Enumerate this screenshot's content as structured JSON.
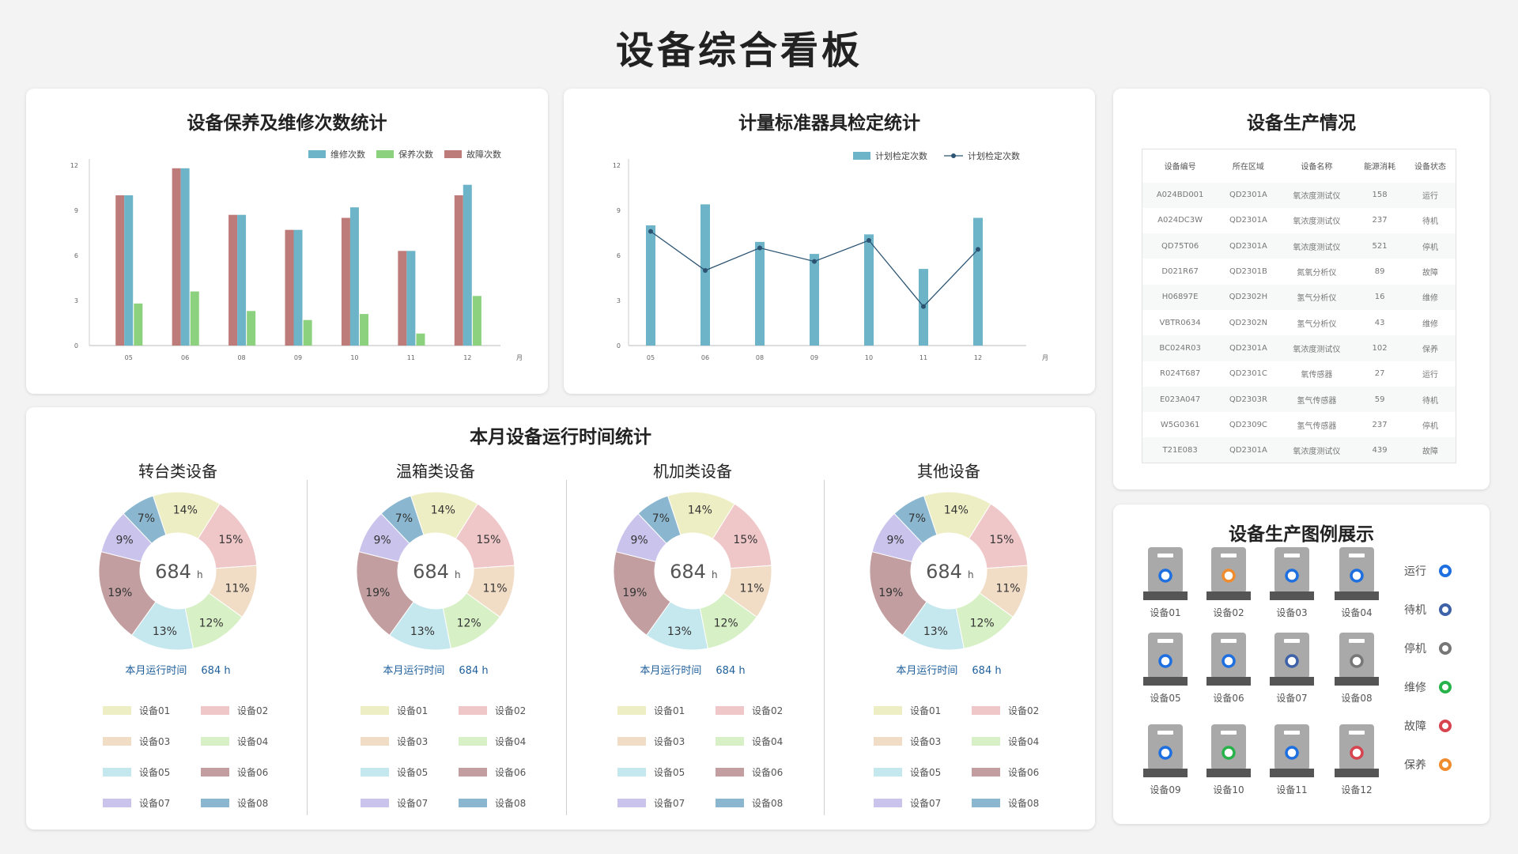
{
  "page_title": "设备综合看板",
  "colors": {
    "run": "#1e6fe0",
    "standby": "#3e62a8",
    "stop": "#777777",
    "maintain": "#27b24a",
    "fault": "#d7434f",
    "upkeep": "#f08c2d"
  },
  "cards": {
    "maint_title": "设备保养及维修次数统计",
    "calib_title": "计量标准器具检定统计",
    "prod_title": "设备生产情况",
    "runtime_title": "本月设备运行时间统计",
    "legend_title": "设备生产图例展示"
  },
  "chart_data": [
    {
      "type": "bar",
      "title": "设备保养及维修次数统计",
      "categories": [
        "05",
        "06",
        "08",
        "09",
        "10",
        "11",
        "12"
      ],
      "x_unit": "月",
      "ylim": [
        0,
        12
      ],
      "yticks": [
        0,
        3,
        6,
        9,
        12
      ],
      "series": [
        {
          "name": "故障次数",
          "color": "#bd7c79",
          "values": [
            10,
            11.8,
            8.7,
            7.7,
            8.5,
            6.3,
            10
          ]
        },
        {
          "name": "维修次数",
          "color": "#6eb4c8",
          "values": [
            10,
            11.8,
            8.7,
            7.7,
            9.2,
            6.3,
            10.7
          ]
        },
        {
          "name": "保养次数",
          "color": "#8bd17e",
          "values": [
            2.8,
            3.6,
            2.3,
            1.7,
            2.1,
            0.8,
            3.3
          ]
        }
      ],
      "legend": [
        {
          "name": "维修次数",
          "color": "#6eb4c8"
        },
        {
          "name": "保养次数",
          "color": "#8bd17e"
        },
        {
          "name": "故障次数",
          "color": "#bd7c79"
        }
      ]
    },
    {
      "type": "bar",
      "title": "计量标准器具检定统计",
      "categories": [
        "05",
        "06",
        "08",
        "09",
        "10",
        "11",
        "12"
      ],
      "x_unit": "月",
      "ylim": [
        0,
        12
      ],
      "yticks": [
        0,
        3,
        6,
        9,
        12
      ],
      "series": [
        {
          "name": "计划检定次数",
          "kind": "bar",
          "color": "#6eb4c8",
          "values": [
            8,
            9.4,
            6.9,
            6.1,
            7.4,
            5.1,
            8.5
          ]
        },
        {
          "name": "计划检定次数",
          "kind": "line",
          "color": "#2c5472",
          "values": [
            7.6,
            5,
            6.5,
            5.6,
            7,
            2.6,
            6.4
          ]
        }
      ]
    },
    {
      "type": "pie",
      "title": "转台类设备",
      "center_value": "684",
      "center_unit": "h",
      "summary_label": "本月运行时间",
      "summary_value": "684 h",
      "slices": [
        {
          "label": "设备01",
          "pct": 14,
          "color": "#eeeec5"
        },
        {
          "label": "设备02",
          "pct": 15,
          "color": "#f0c7c9"
        },
        {
          "label": "设备03",
          "pct": 11,
          "color": "#f1dcc6"
        },
        {
          "label": "设备04",
          "pct": 12,
          "color": "#d7f0c5"
        },
        {
          "label": "设备05",
          "pct": 13,
          "color": "#c5e7ee"
        },
        {
          "label": "设备06",
          "pct": 19,
          "color": "#c29ea0"
        },
        {
          "label": "设备07",
          "pct": 9,
          "color": "#cac4ed"
        },
        {
          "label": "设备08",
          "pct": 7,
          "color": "#8ab7cf"
        }
      ]
    },
    {
      "type": "pie",
      "title": "温箱类设备",
      "center_value": "684",
      "center_unit": "h",
      "summary_label": "本月运行时间",
      "summary_value": "684 h",
      "slices": [
        {
          "label": "设备01",
          "pct": 14,
          "color": "#eeeec5"
        },
        {
          "label": "设备02",
          "pct": 15,
          "color": "#f0c7c9"
        },
        {
          "label": "设备03",
          "pct": 11,
          "color": "#f1dcc6"
        },
        {
          "label": "设备04",
          "pct": 12,
          "color": "#d7f0c5"
        },
        {
          "label": "设备05",
          "pct": 13,
          "color": "#c5e7ee"
        },
        {
          "label": "设备06",
          "pct": 19,
          "color": "#c29ea0"
        },
        {
          "label": "设备07",
          "pct": 9,
          "color": "#cac4ed"
        },
        {
          "label": "设备08",
          "pct": 7,
          "color": "#8ab7cf"
        }
      ]
    },
    {
      "type": "pie",
      "title": "机加类设备",
      "center_value": "684",
      "center_unit": "h",
      "summary_label": "本月运行时间",
      "summary_value": "684 h",
      "slices": [
        {
          "label": "设备01",
          "pct": 14,
          "color": "#eeeec5"
        },
        {
          "label": "设备02",
          "pct": 15,
          "color": "#f0c7c9"
        },
        {
          "label": "设备03",
          "pct": 11,
          "color": "#f1dcc6"
        },
        {
          "label": "设备04",
          "pct": 12,
          "color": "#d7f0c5"
        },
        {
          "label": "设备05",
          "pct": 13,
          "color": "#c5e7ee"
        },
        {
          "label": "设备06",
          "pct": 19,
          "color": "#c29ea0"
        },
        {
          "label": "设备07",
          "pct": 9,
          "color": "#cac4ed"
        },
        {
          "label": "设备08",
          "pct": 7,
          "color": "#8ab7cf"
        }
      ]
    },
    {
      "type": "pie",
      "title": "其他设备",
      "center_value": "684",
      "center_unit": "h",
      "summary_label": "本月运行时间",
      "summary_value": "684 h",
      "slices": [
        {
          "label": "设备01",
          "pct": 14,
          "color": "#eeeec5"
        },
        {
          "label": "设备02",
          "pct": 15,
          "color": "#f0c7c9"
        },
        {
          "label": "设备03",
          "pct": 11,
          "color": "#f1dcc6"
        },
        {
          "label": "设备04",
          "pct": 12,
          "color": "#d7f0c5"
        },
        {
          "label": "设备05",
          "pct": 13,
          "color": "#c5e7ee"
        },
        {
          "label": "设备06",
          "pct": 19,
          "color": "#c29ea0"
        },
        {
          "label": "设备07",
          "pct": 9,
          "color": "#cac4ed"
        },
        {
          "label": "设备08",
          "pct": 7,
          "color": "#8ab7cf"
        }
      ]
    }
  ],
  "production_table": {
    "headers": [
      "设备编号",
      "所在区域",
      "设备名称",
      "能源消耗",
      "设备状态"
    ],
    "rows": [
      [
        "A024BD001",
        "QD2301A",
        "氧浓度测试仪",
        "158",
        "运行"
      ],
      [
        "A024DC3W",
        "QD2301A",
        "氧浓度测试仪",
        "237",
        "待机"
      ],
      [
        "QD75T06",
        "QD2301A",
        "氧浓度测试仪",
        "521",
        "停机"
      ],
      [
        "D021R67",
        "QD2301B",
        "氮氧分析仪",
        "89",
        "故障"
      ],
      [
        "H06897E",
        "QD2302H",
        "氢气分析仪",
        "16",
        "维修"
      ],
      [
        "VBTR0634",
        "QD2302N",
        "氢气分析仪",
        "43",
        "维修"
      ],
      [
        "BC024R03",
        "QD2301A",
        "氧浓度测试仪",
        "102",
        "保养"
      ],
      [
        "R024T687",
        "QD2301C",
        "氧传感器",
        "27",
        "运行"
      ],
      [
        "E023A047",
        "QD2303R",
        "氢气传感器",
        "59",
        "待机"
      ],
      [
        "W5G0361",
        "QD2309C",
        "氢气传感器",
        "237",
        "停机"
      ],
      [
        "T21E083",
        "QD2301A",
        "氧浓度测试仪",
        "439",
        "故障"
      ]
    ]
  },
  "devices": [
    {
      "label": "设备01",
      "status": "run"
    },
    {
      "label": "设备02",
      "status": "upkeep"
    },
    {
      "label": "设备03",
      "status": "run"
    },
    {
      "label": "设备04",
      "status": "run"
    },
    {
      "label": "设备05",
      "status": "run"
    },
    {
      "label": "设备06",
      "status": "run"
    },
    {
      "label": "设备07",
      "status": "standby"
    },
    {
      "label": "设备08",
      "status": "stop"
    },
    {
      "label": "设备09",
      "status": "run"
    },
    {
      "label": "设备10",
      "status": "maintain"
    },
    {
      "label": "设备11",
      "status": "run"
    },
    {
      "label": "设备12",
      "status": "fault"
    }
  ],
  "status_legend": [
    {
      "key": "run",
      "label": "运行"
    },
    {
      "key": "standby",
      "label": "待机"
    },
    {
      "key": "stop",
      "label": "停机"
    },
    {
      "key": "maintain",
      "label": "维修"
    },
    {
      "key": "fault",
      "label": "故障"
    },
    {
      "key": "upkeep",
      "label": "保养"
    }
  ]
}
